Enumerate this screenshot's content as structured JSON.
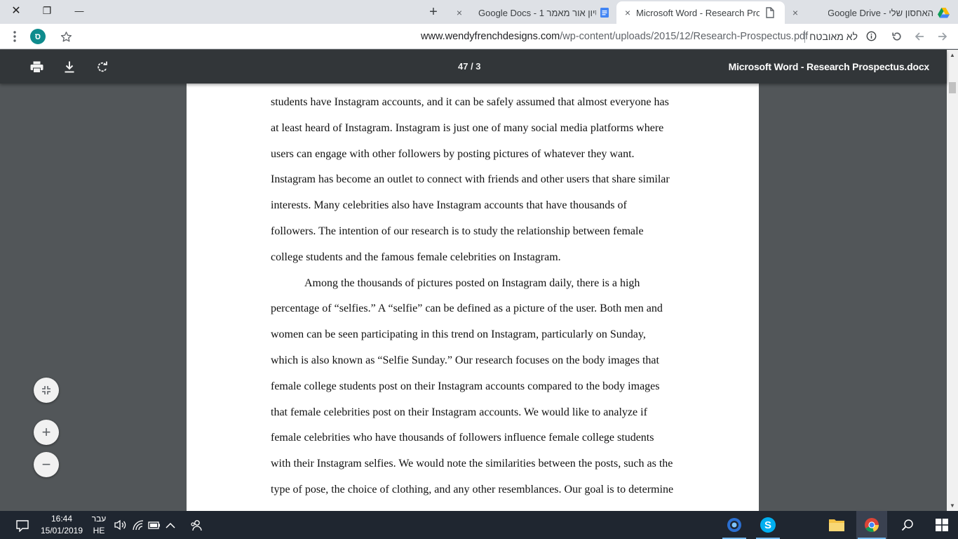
{
  "tabs": [
    {
      "title": "Google Docs - סיון אור מאמר 1",
      "close": "×",
      "favicon": "docs-icon"
    },
    {
      "title": "Microsoft Word - Research Prosp",
      "close": "×",
      "favicon": "pdf-file-icon",
      "active": true
    },
    {
      "title": "האחסון שלי - Google Drive",
      "close": "×",
      "favicon": "drive-icon"
    }
  ],
  "window_controls": {
    "close": "✕",
    "restore": "❐",
    "minimize": "—",
    "new_tab": "+"
  },
  "toolbar": {
    "profile_initial": "ס",
    "url_host": "www.wendyfrenchdesigns.com",
    "url_path": "/wp-content/uploads/2015/12/Research-Prospectus.pdf",
    "security_label": "לא מאובטח",
    "icons": [
      "menu-icon",
      "star-icon",
      "info-icon",
      "reload-icon",
      "back-icon",
      "forward-icon"
    ]
  },
  "pdf": {
    "page_indicator": "47 / 3",
    "document_title": "Microsoft Word - Research Prospectus.docx",
    "lines": [
      {
        "text": "students have Instagram accounts, and it can be safely assumed that almost everyone has",
        "indent": false
      },
      {
        "text": "at least heard of Instagram. Instagram is just one of many social media platforms where",
        "indent": false
      },
      {
        "text": "users can engage with other followers by posting pictures of whatever they want.",
        "indent": false
      },
      {
        "text": "Instagram has become an outlet to connect with friends and other users that share similar",
        "indent": false
      },
      {
        "text": "interests. Many celebrities also have Instagram accounts that have thousands of",
        "indent": false
      },
      {
        "text": "followers. The intention of our research is to study the relationship between female",
        "indent": false
      },
      {
        "text": "college students and the famous female celebrities on Instagram.",
        "indent": false
      },
      {
        "text": "Among the thousands of pictures posted on Instagram daily, there is a high",
        "indent": true
      },
      {
        "text": "percentage of “selfies.” A “selfie” can be defined as a picture of the user. Both men and",
        "indent": false
      },
      {
        "text": "women can be seen participating in this trend on Instagram, particularly on Sunday,",
        "indent": false
      },
      {
        "text": "which is also known as “Selfie Sunday.” Our research focuses on the body images that",
        "indent": false
      },
      {
        "text": "female college students post on their Instagram accounts compared to the body images",
        "indent": false
      },
      {
        "text": "that female celebrities post on their Instagram accounts. We would like to analyze if",
        "indent": false
      },
      {
        "text": "female celebrities who have thousands of followers influence female college students",
        "indent": false
      },
      {
        "text": "with their Instagram selfies. We would note the similarities between the posts, such as the",
        "indent": false
      },
      {
        "text": "type of pose, the choice of clothing, and any other resemblances. Our goal is to determine",
        "indent": false
      }
    ],
    "fab": {
      "fit": "⤢",
      "zoom_in": "+",
      "zoom_out": "−"
    }
  },
  "taskbar": {
    "time": "16:44",
    "date": "15/01/2019",
    "lang_top": "עבר",
    "lang_bottom": "HE"
  },
  "colors": {
    "tab_strip": "#dee1e6",
    "pdf_toolbar": "#323639",
    "pdf_background": "#525659",
    "taskbar": "#1f2630",
    "profile": "#0e8b8d"
  }
}
